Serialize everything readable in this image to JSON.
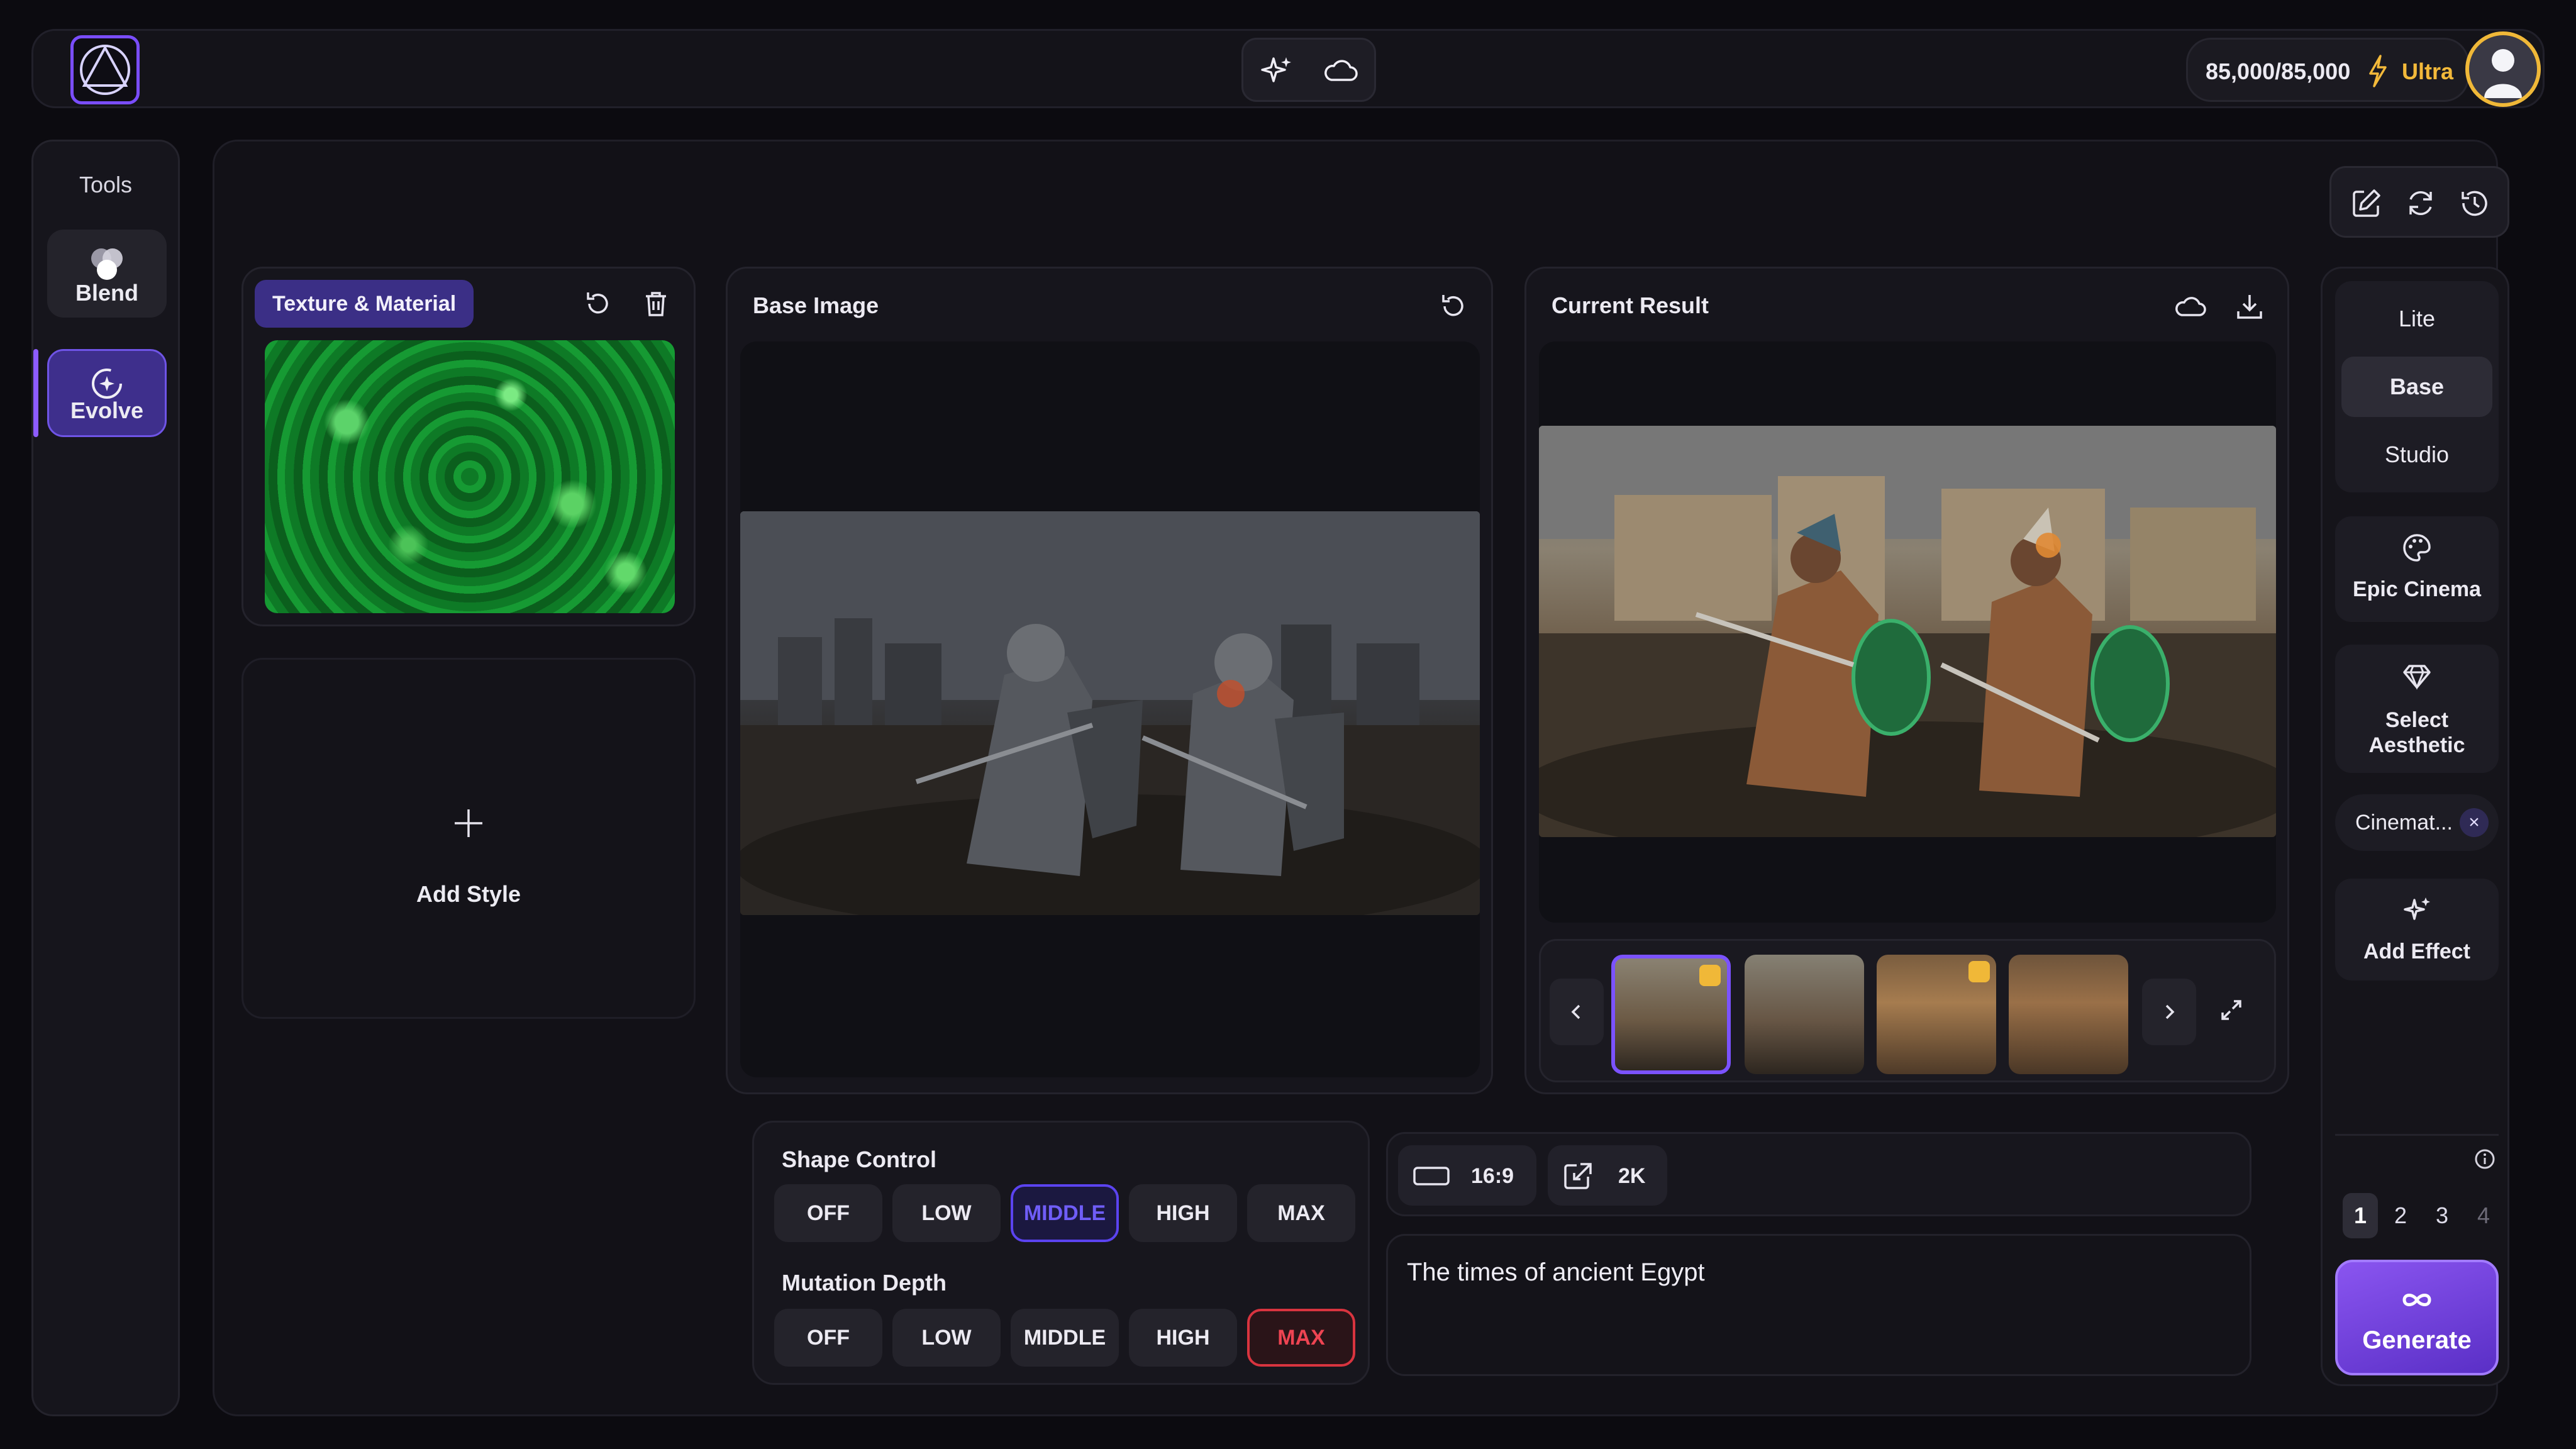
{
  "header": {
    "credits": "85,000/85,000",
    "tier": "Ultra"
  },
  "tools": {
    "title": "Tools",
    "items": [
      {
        "label": "Blend"
      },
      {
        "label": "Evolve"
      }
    ]
  },
  "texture": {
    "chip_label": "Texture & Material"
  },
  "add_style": {
    "label": "Add Style"
  },
  "base_image": {
    "title": "Base Image"
  },
  "result": {
    "title": "Current Result"
  },
  "quality": {
    "options": [
      "Lite",
      "Base",
      "Studio"
    ],
    "selected": "Base"
  },
  "side": {
    "style_label": "Epic Cinema",
    "aesthetic_label": [
      "Select",
      "Aesthetic"
    ],
    "chip_label": "Cinemat...",
    "effect_label": "Add Effect",
    "pages": [
      "1",
      "2",
      "3",
      "4"
    ],
    "generate_label": "Generate"
  },
  "shape_control": {
    "title": "Shape Control",
    "options": [
      "OFF",
      "LOW",
      "MIDDLE",
      "HIGH",
      "MAX"
    ],
    "selected": "MIDDLE"
  },
  "mutation_depth": {
    "title": "Mutation Depth",
    "options": [
      "OFF",
      "LOW",
      "MIDDLE",
      "HIGH",
      "MAX"
    ],
    "selected": "MAX"
  },
  "params": {
    "aspect_ratio": "16:9",
    "resolution": "2K"
  },
  "prompt": {
    "text": "The times of ancient Egypt"
  },
  "colors": {
    "accent": "#7b52ff",
    "tier": "#f3b93a",
    "danger": "#d8343f"
  }
}
